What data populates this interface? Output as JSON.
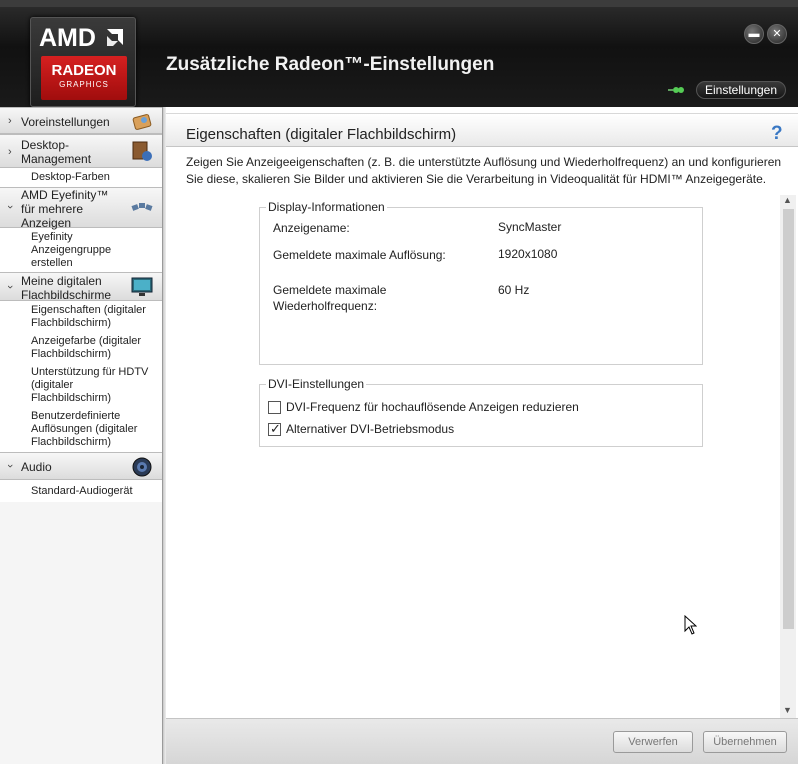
{
  "header": {
    "logo": {
      "brand": "AMD",
      "product": "RADEON",
      "subtitle": "GRAPHICS"
    },
    "title": "Zusätzliche Radeon™-Einstellungen",
    "settings_button": "Einstellungen",
    "window_buttons": [
      "minimize-icon",
      "close-icon"
    ]
  },
  "sidebar": {
    "categories": [
      {
        "label": "Voreinstellungen",
        "expanded": false,
        "icon": "preset-icon",
        "items": []
      },
      {
        "label_lines": [
          "Desktop-",
          "Management"
        ],
        "expanded": false,
        "icon": "desktop-management-icon",
        "items": [
          "Desktop-Farben"
        ]
      },
      {
        "label_lines": [
          "AMD Eyefinity™",
          "für mehrere",
          "Anzeigen"
        ],
        "expanded": true,
        "icon": "eyefinity-icon",
        "items": [
          [
            "Eyefinity",
            "Anzeigengruppe",
            "erstellen"
          ]
        ]
      },
      {
        "label_lines": [
          "Meine digitalen",
          "Flachbildschirme"
        ],
        "expanded": true,
        "icon": "monitor-icon",
        "items": [
          [
            "Eigenschaften (digitaler",
            "Flachbildschirm)"
          ],
          [
            "Anzeigefarbe (digitaler",
            "Flachbildschirm)"
          ],
          [
            "Unterstützung für HDTV",
            "(digitaler",
            "Flachbildschirm)"
          ],
          [
            "Benutzerdefinierte",
            "Auflösungen (digitaler",
            "Flachbildschirm)"
          ]
        ]
      },
      {
        "label": "Audio",
        "expanded": true,
        "icon": "speaker-icon",
        "items": [
          "Standard-Audiogerät"
        ]
      }
    ]
  },
  "main": {
    "title": "Eigenschaften (digitaler Flachbildschirm)",
    "help": "?",
    "description": "Zeigen Sie Anzeigeeigenschaften (z. B. die unterstützte Auflösung und Wiederholfrequenz) an und konfigurieren Sie diese, skalieren Sie Bilder und aktivieren Sie die Verarbeitung in Videoqualität für HDMI™ Anzeigegeräte.",
    "display_info": {
      "legend": "Display-Informationen",
      "rows": [
        {
          "label": "Anzeigename:",
          "value": "SyncMaster"
        },
        {
          "label": "Gemeldete maximale Auflösung:",
          "value": "1920x1080"
        },
        {
          "label_lines": [
            "Gemeldete maximale",
            "Wiederholfrequenz:"
          ],
          "value": "60 Hz"
        }
      ]
    },
    "dvi_settings": {
      "legend": "DVI-Einstellungen",
      "options": [
        {
          "label": "DVI-Frequenz für hochauflösende Anzeigen reduzieren",
          "checked": false
        },
        {
          "label": "Alternativer DVI-Betriebsmodus",
          "checked": true
        }
      ]
    },
    "buttons": {
      "discard": "Verwerfen",
      "apply": "Übernehmen"
    }
  },
  "colors": {
    "accent_red": "#c4161c",
    "help_blue": "#3a78c4",
    "header_bg": "#111111"
  }
}
